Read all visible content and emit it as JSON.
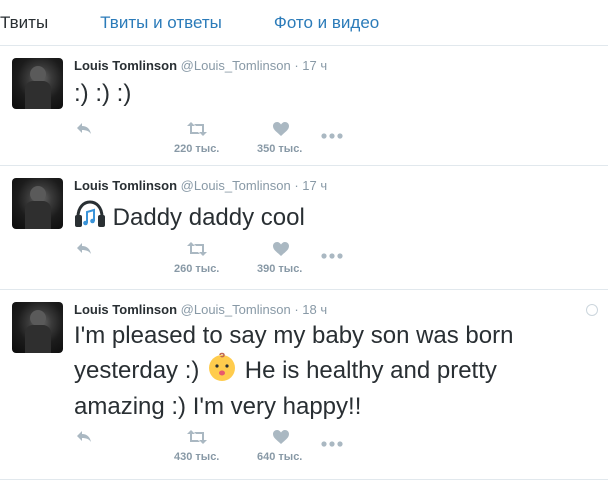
{
  "tabs": [
    "Твиты",
    "Твиты и ответы",
    "Фото и видео"
  ],
  "tweets": [
    {
      "name": "Louis Tomlinson",
      "handle": "@Louis_Tomlinson",
      "separator": "·",
      "time": "17 ч",
      "text": ":) :) :)",
      "retweets": "220 тыс.",
      "likes": "350 тыс."
    },
    {
      "name": "Louis Tomlinson",
      "handle": "@Louis_Tomlinson",
      "separator": "·",
      "time": "17 ч",
      "text": "Daddy daddy cool",
      "retweets": "260 тыс.",
      "likes": "390 тыс."
    },
    {
      "name": "Louis Tomlinson",
      "handle": "@Louis_Tomlinson",
      "separator": "·",
      "time": "18 ч",
      "text_part1": "I'm pleased to say my baby son was born yesterday :)",
      "text_part2": "He is healthy and pretty amazing :) I'm very happy!!",
      "retweets": "430 тыс.",
      "likes": "640 тыс."
    }
  ],
  "icons": {
    "reply": "reply-icon",
    "retweet": "retweet-icon",
    "like": "heart-icon",
    "more": "more-icon",
    "headphones": "headphones-emoji",
    "baby": "baby-emoji"
  }
}
